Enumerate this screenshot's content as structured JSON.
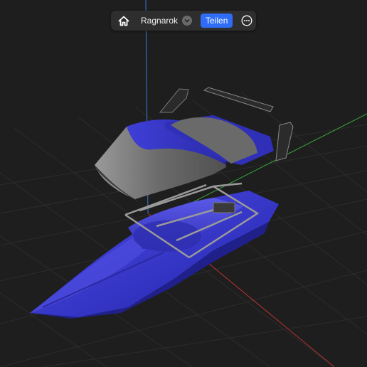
{
  "toolbar": {
    "title": "Ragnarok",
    "share_label": "Teilen"
  },
  "icons": {
    "home": "home-icon",
    "dropdown": "chevron-down-icon",
    "more": "ellipsis-circle-icon"
  },
  "colors": {
    "background": "#1e1e1e",
    "grid": "#2b2b2b",
    "accent": "#2f6df6",
    "axis_x": "#b83232",
    "axis_y": "#38a838",
    "axis_z": "#3a7ad8",
    "hull": "#3434c8",
    "canopy": "#6e6e6e"
  }
}
